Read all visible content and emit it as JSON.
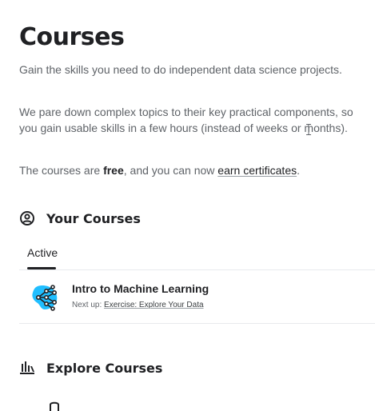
{
  "page": {
    "title": "Courses",
    "intro": {
      "line1": "Gain the skills you need to do independent data science projects.",
      "line2": "We pare down complex topics to their key practical components, so you gain usable skills in a few hours (instead of weeks or months).",
      "line3_prefix": "The courses are ",
      "line3_bold": "free",
      "line3_middle": ", and you can now ",
      "line3_link": "earn certificates",
      "line3_suffix": "."
    }
  },
  "your_courses": {
    "heading": "Your Courses",
    "icon": "account-circle-icon",
    "tabs": [
      {
        "label": "Active",
        "selected": true
      }
    ],
    "items": [
      {
        "title": "Intro to Machine Learning",
        "next_prefix": "Next up: ",
        "next_link": "Exercise: Explore Your Data",
        "icon": "machine-learning-course-icon"
      }
    ]
  },
  "explore": {
    "heading": "Explore Courses",
    "icon": "bar-chart-icon"
  },
  "colors": {
    "text": "#202124",
    "muted": "#5f6368",
    "accent_blue": "#20beff",
    "divider": "#e8eaed"
  }
}
